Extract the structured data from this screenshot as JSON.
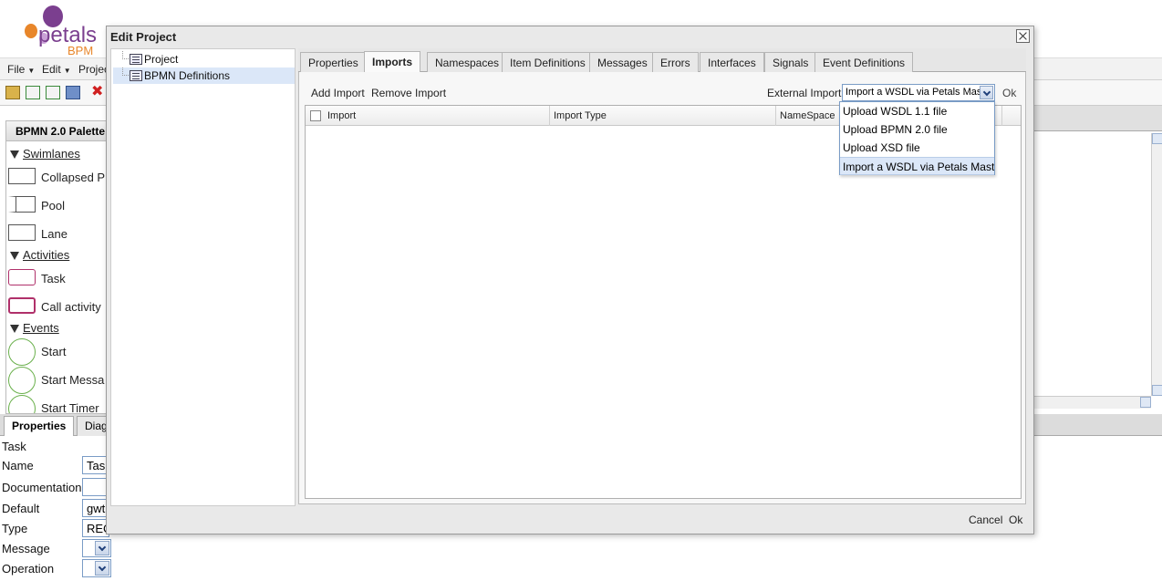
{
  "app": {
    "brand_name": "petals",
    "brand_sub": "BPM",
    "menu": [
      {
        "label": "File"
      },
      {
        "label": "Edit"
      },
      {
        "label": "Projec"
      }
    ],
    "palette": {
      "title": "BPMN 2.0 Palette",
      "groups": {
        "swimlanes": "Swimlanes",
        "activities": "Activities",
        "events": "Events"
      },
      "items": {
        "collapsed_pool": "Collapsed P",
        "pool": "Pool",
        "lane": "Lane",
        "task": "Task",
        "call_activity": "Call activity",
        "start": "Start",
        "start_message": "Start Messa",
        "start_timer": "Start Timer"
      }
    },
    "properties": {
      "tabs": [
        {
          "label": "Properties"
        },
        {
          "label": "Diagr"
        }
      ],
      "heading": "Task",
      "rows": [
        {
          "label": "Name",
          "value": "Tas"
        },
        {
          "label": "Documentation",
          "value": ""
        },
        {
          "label": "Default",
          "value": "gwt"
        },
        {
          "label": "Type",
          "value": "REC"
        },
        {
          "label": "Message",
          "value": ""
        },
        {
          "label": "Operation",
          "value": ""
        }
      ]
    }
  },
  "dialog": {
    "title": "Edit Project",
    "tree": [
      {
        "label": "Project"
      },
      {
        "label": "BPMN Definitions"
      }
    ],
    "tabs": [
      {
        "label": "Properties"
      },
      {
        "label": "Imports"
      },
      {
        "label": "Namespaces"
      },
      {
        "label": "Item Definitions"
      },
      {
        "label": "Messages"
      },
      {
        "label": "Errors"
      },
      {
        "label": "Interfaces"
      },
      {
        "label": "Signals"
      },
      {
        "label": "Event Definitions"
      }
    ],
    "active_tab": "Imports",
    "toolbar": {
      "add_import": "Add Import",
      "remove_import": "Remove Import",
      "external_import_label": "External Import:",
      "external_import_value": "Import a WSDL via Petals Mast",
      "ok": "Ok"
    },
    "grid": {
      "columns": [
        "Import",
        "Import Type",
        "NameSpace"
      ],
      "rows": []
    },
    "dropdown_options": [
      "Upload WSDL 1.1 file",
      "Upload BPMN 2.0 file",
      "Upload XSD file",
      "Import a WSDL via Petals Mast"
    ],
    "footer": {
      "cancel": "Cancel",
      "ok": "Ok"
    }
  },
  "colors": {
    "brand_purple": "#7b3f8f",
    "brand_orange": "#e8862a",
    "task_border": "#b0306a",
    "event_green": "#6ab04c",
    "selection": "#dbe7f8"
  }
}
